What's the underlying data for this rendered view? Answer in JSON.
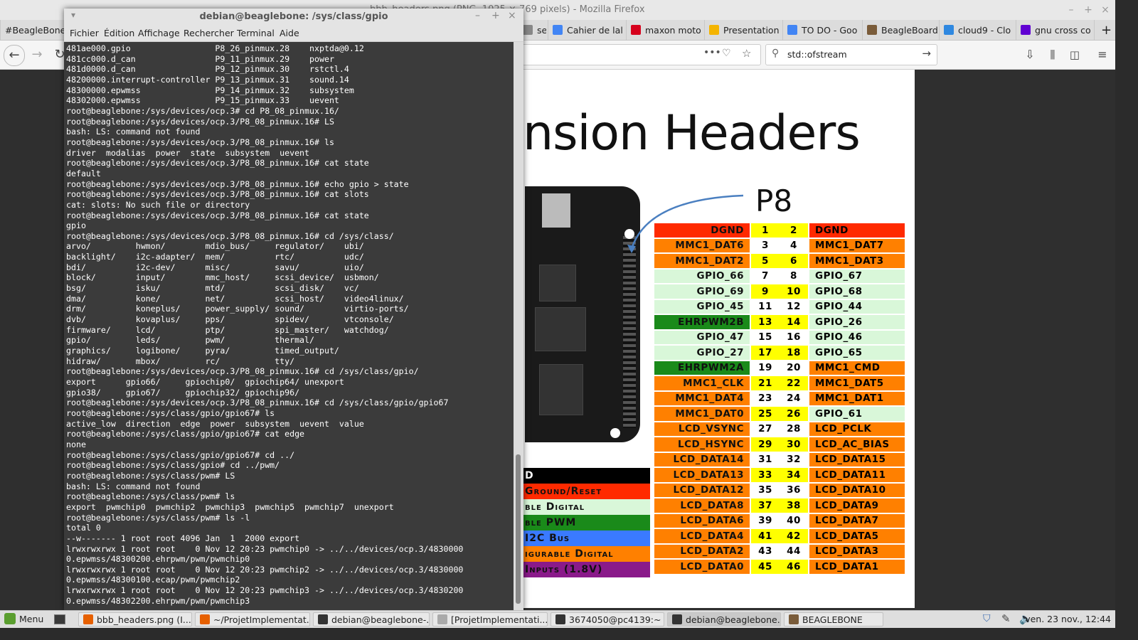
{
  "firefox": {
    "window_title": "bbb_headers.png (PNG, 1025 × 769 pixels) - Mozilla Firefox",
    "tabs": [
      {
        "label": "#BeagleBone",
        "icon": "hash-icon",
        "color": "#555555"
      },
      {
        "label": "se",
        "icon": "page-icon",
        "color": "#888888"
      },
      {
        "label": "Cahier de lal",
        "icon": "docs-icon",
        "color": "#4285f4"
      },
      {
        "label": "maxon moto",
        "icon": "maxon-icon",
        "color": "#d6001c"
      },
      {
        "label": "Presentation",
        "icon": "slides-icon",
        "color": "#f4b400"
      },
      {
        "label": "TO DO - Goo",
        "icon": "docs-icon",
        "color": "#4285f4"
      },
      {
        "label": "BeagleBoard",
        "icon": "beagle-icon",
        "color": "#7a5c3a"
      },
      {
        "label": "cloud9 - Clo",
        "icon": "cloud-icon",
        "color": "#2f88e0"
      },
      {
        "label": "gnu cross co",
        "icon": "yahoo-icon",
        "color": "#6001d2"
      }
    ],
    "new_tab_label": "+",
    "search_text": "std::ofstream",
    "image": {
      "title": "nsion Headers",
      "header_label": "P8",
      "pins": [
        {
          "left": "DGND",
          "lnum": "1",
          "rnum": "2",
          "right": "DGND",
          "lcolor": "#ff2a00",
          "rcolor": "#ff2a00",
          "lnumhi": true,
          "rnumhi": true
        },
        {
          "left": "MMC1_DAT6",
          "lnum": "3",
          "rnum": "4",
          "right": "MMC1_DAT7",
          "lcolor": "#ff8000",
          "rcolor": "#ff8000",
          "lnumhi": false,
          "rnumhi": false
        },
        {
          "left": "MMC1_DAT2",
          "lnum": "5",
          "rnum": "6",
          "right": "MMC1_DAT3",
          "lcolor": "#ff8000",
          "rcolor": "#ff8000",
          "lnumhi": true,
          "rnumhi": true
        },
        {
          "left": "GPIO_66",
          "lnum": "7",
          "rnum": "8",
          "right": "GPIO_67",
          "lcolor": "#d9f7d9",
          "rcolor": "#d9f7d9",
          "lnumhi": false,
          "rnumhi": false
        },
        {
          "left": "GPIO_69",
          "lnum": "9",
          "rnum": "10",
          "right": "GPIO_68",
          "lcolor": "#d9f7d9",
          "rcolor": "#d9f7d9",
          "lnumhi": true,
          "rnumhi": true
        },
        {
          "left": "GPIO_45",
          "lnum": "11",
          "rnum": "12",
          "right": "GPIO_44",
          "lcolor": "#d9f7d9",
          "rcolor": "#d9f7d9",
          "lnumhi": false,
          "rnumhi": false
        },
        {
          "left": "EHRPWM2B",
          "lnum": "13",
          "rnum": "14",
          "right": "GPIO_26",
          "lcolor": "#1a8a1a",
          "rcolor": "#d9f7d9",
          "lnumhi": true,
          "rnumhi": true
        },
        {
          "left": "GPIO_47",
          "lnum": "15",
          "rnum": "16",
          "right": "GPIO_46",
          "lcolor": "#d9f7d9",
          "rcolor": "#d9f7d9",
          "lnumhi": false,
          "rnumhi": false
        },
        {
          "left": "GPIO_27",
          "lnum": "17",
          "rnum": "18",
          "right": "GPIO_65",
          "lcolor": "#d9f7d9",
          "rcolor": "#d9f7d9",
          "lnumhi": true,
          "rnumhi": true
        },
        {
          "left": "EHRPWM2A",
          "lnum": "19",
          "rnum": "20",
          "right": "MMC1_CMD",
          "lcolor": "#1a8a1a",
          "rcolor": "#ff8000",
          "lnumhi": false,
          "rnumhi": false
        },
        {
          "left": "MMC1_CLK",
          "lnum": "21",
          "rnum": "22",
          "right": "MMC1_DAT5",
          "lcolor": "#ff8000",
          "rcolor": "#ff8000",
          "lnumhi": true,
          "rnumhi": true
        },
        {
          "left": "MMC1_DAT4",
          "lnum": "23",
          "rnum": "24",
          "right": "MMC1_DAT1",
          "lcolor": "#ff8000",
          "rcolor": "#ff8000",
          "lnumhi": false,
          "rnumhi": false
        },
        {
          "left": "MMC1_DAT0",
          "lnum": "25",
          "rnum": "26",
          "right": "GPIO_61",
          "lcolor": "#ff8000",
          "rcolor": "#d9f7d9",
          "lnumhi": true,
          "rnumhi": true
        },
        {
          "left": "LCD_VSYNC",
          "lnum": "27",
          "rnum": "28",
          "right": "LCD_PCLK",
          "lcolor": "#ff8000",
          "rcolor": "#ff8000",
          "lnumhi": false,
          "rnumhi": false
        },
        {
          "left": "LCD_HSYNC",
          "lnum": "29",
          "rnum": "30",
          "right": "LCD_AC_BIAS",
          "lcolor": "#ff8000",
          "rcolor": "#ff8000",
          "lnumhi": true,
          "rnumhi": true
        },
        {
          "left": "LCD_DATA14",
          "lnum": "31",
          "rnum": "32",
          "right": "LCD_DATA15",
          "lcolor": "#ff8000",
          "rcolor": "#ff8000",
          "lnumhi": false,
          "rnumhi": false
        },
        {
          "left": "LCD_DATA13",
          "lnum": "33",
          "rnum": "34",
          "right": "LCD_DATA11",
          "lcolor": "#ff8000",
          "rcolor": "#ff8000",
          "lnumhi": true,
          "rnumhi": true
        },
        {
          "left": "LCD_DATA12",
          "lnum": "35",
          "rnum": "36",
          "right": "LCD_DATA10",
          "lcolor": "#ff8000",
          "rcolor": "#ff8000",
          "lnumhi": false,
          "rnumhi": false
        },
        {
          "left": "LCD_DATA8",
          "lnum": "37",
          "rnum": "38",
          "right": "LCD_DATA9",
          "lcolor": "#ff8000",
          "rcolor": "#ff8000",
          "lnumhi": true,
          "rnumhi": true
        },
        {
          "left": "LCD_DATA6",
          "lnum": "39",
          "rnum": "40",
          "right": "LCD_DATA7",
          "lcolor": "#ff8000",
          "rcolor": "#ff8000",
          "lnumhi": false,
          "rnumhi": false
        },
        {
          "left": "LCD_DATA4",
          "lnum": "41",
          "rnum": "42",
          "right": "LCD_DATA5",
          "lcolor": "#ff8000",
          "rcolor": "#ff8000",
          "lnumhi": true,
          "rnumhi": true
        },
        {
          "left": "LCD_DATA2",
          "lnum": "43",
          "rnum": "44",
          "right": "LCD_DATA3",
          "lcolor": "#ff8000",
          "rcolor": "#ff8000",
          "lnumhi": false,
          "rnumhi": false
        },
        {
          "left": "LCD_DATA0",
          "lnum": "45",
          "rnum": "46",
          "right": "LCD_DATA1",
          "lcolor": "#ff8000",
          "rcolor": "#ff8000",
          "lnumhi": true,
          "rnumhi": true
        }
      ],
      "legend": [
        {
          "label": "D",
          "bg": "#000000",
          "fg": "#ffffff"
        },
        {
          "label": "Ground/Reset",
          "bg": "#ff2a00",
          "fg": "#111111"
        },
        {
          "label": "ble Digital",
          "bg": "#d9f7d9",
          "fg": "#111111"
        },
        {
          "label": "ble PWM",
          "bg": "#1a8a1a",
          "fg": "#111111"
        },
        {
          "label": "I2C Bus",
          "bg": "#3a7aff",
          "fg": "#111111"
        },
        {
          "label": "igurable Digital",
          "bg": "#ff8000",
          "fg": "#111111"
        },
        {
          "label": "Inputs (1.8V)",
          "bg": "#8a1a8a",
          "fg": "#111111"
        }
      ]
    }
  },
  "terminal": {
    "title": "debian@beaglebone: /sys/class/gpio",
    "menu": [
      "Fichier",
      "Édition",
      "Affichage",
      "Rechercher",
      "Terminal",
      "Aide"
    ],
    "lines": [
      "481ae000.gpio                 P8_26_pinmux.28    nxptda@0.12",
      "481cc000.d_can                P9_11_pinmux.29    power",
      "481d0000.d_can                P9_12_pinmux.30    rstctl.4",
      "48200000.interrupt-controller P9_13_pinmux.31    sound.14",
      "48300000.epwmss               P9_14_pinmux.32    subsystem",
      "48302000.epwmss               P9_15_pinmux.33    uevent",
      "root@beaglebone:/sys/devices/ocp.3# cd P8_08_pinmux.16/",
      "root@beaglebone:/sys/devices/ocp.3/P8_08_pinmux.16# LS",
      "bash: LS: command not found",
      "root@beaglebone:/sys/devices/ocp.3/P8_08_pinmux.16# ls",
      "driver  modalias  power  state  subsystem  uevent",
      "root@beaglebone:/sys/devices/ocp.3/P8_08_pinmux.16# cat state",
      "default",
      "root@beaglebone:/sys/devices/ocp.3/P8_08_pinmux.16# echo gpio > state",
      "root@beaglebone:/sys/devices/ocp.3/P8_08_pinmux.16# cat slots",
      "cat: slots: No such file or directory",
      "root@beaglebone:/sys/devices/ocp.3/P8_08_pinmux.16# cat state",
      "gpio",
      "root@beaglebone:/sys/devices/ocp.3/P8_08_pinmux.16# cd /sys/class/",
      "arvo/         hwmon/        mdio_bus/     regulator/    ubi/",
      "backlight/    i2c-adapter/  mem/          rtc/          udc/",
      "bdi/          i2c-dev/      misc/         savu/         uio/",
      "block/        input/        mmc_host/     scsi_device/  usbmon/",
      "bsg/          isku/         mtd/          scsi_disk/    vc/",
      "dma/          kone/         net/          scsi_host/    video4linux/",
      "drm/          koneplus/     power_supply/ sound/        virtio-ports/",
      "dvb/          kovaplus/     pps/          spidev/       vtconsole/",
      "firmware/     lcd/          ptp/          spi_master/   watchdog/",
      "gpio/         leds/         pwm/          thermal/",
      "graphics/     logibone/     pyra/         timed_output/",
      "hidraw/       mbox/         rc/           tty/",
      "root@beaglebone:/sys/devices/ocp.3/P8_08_pinmux.16# cd /sys/class/gpio/",
      "export      gpio66/     gpiochip0/  gpiochip64/ unexport",
      "gpio38/     gpio67/     gpiochip32/ gpiochip96/",
      "root@beaglebone:/sys/devices/ocp.3/P8_08_pinmux.16# cd /sys/class/gpio/gpio67",
      "root@beaglebone:/sys/class/gpio/gpio67# ls",
      "active_low  direction  edge  power  subsystem  uevent  value",
      "root@beaglebone:/sys/class/gpio/gpio67# cat edge",
      "none",
      "root@beaglebone:/sys/class/gpio/gpio67# cd ../",
      "root@beaglebone:/sys/class/gpio# cd ../pwm/",
      "root@beaglebone:/sys/class/pwm# LS",
      "bash: LS: command not found",
      "root@beaglebone:/sys/class/pwm# ls",
      "export  pwmchip0  pwmchip2  pwmchip3  pwmchip5  pwmchip7  unexport",
      "root@beaglebone:/sys/class/pwm# ls -l",
      "total 0",
      "--w------- 1 root root 4096 Jan  1  2000 export",
      "lrwxrwxrwx 1 root root    0 Nov 12 20:23 pwmchip0 -> ../../devices/ocp.3/4830000",
      "0.epwmss/48300200.ehrpwm/pwm/pwmchip0",
      "lrwxrwxrwx 1 root root    0 Nov 12 20:23 pwmchip2 -> ../../devices/ocp.3/4830000",
      "0.epwmss/48300100.ecap/pwm/pwmchip2",
      "lrwxrwxrwx 1 root root    0 Nov 12 20:23 pwmchip3 -> ../../devices/ocp.3/4830200",
      "0.epwmss/48302200.ehrpwm/pwm/pwmchip3"
    ]
  },
  "taskbar": {
    "menu_label": "Menu",
    "tasks": [
      {
        "label": "bbb_headers.png (I...",
        "color": "#e66000",
        "active": false
      },
      {
        "label": "~/ProjetImplementat...",
        "color": "#e66000",
        "active": false
      },
      {
        "label": "debian@beaglebone-...",
        "color": "#333333",
        "active": false
      },
      {
        "label": "[ProjetImplementati...",
        "color": "#aaaaaa",
        "active": false
      },
      {
        "label": "3674050@pc4139:~",
        "color": "#333333",
        "active": false
      },
      {
        "label": "debian@beaglebone...",
        "color": "#333333",
        "active": true
      },
      {
        "label": "BEAGLEBONE",
        "color": "#7a5c3a",
        "active": false
      }
    ],
    "clock": "ven. 23 nov., 12:44"
  }
}
